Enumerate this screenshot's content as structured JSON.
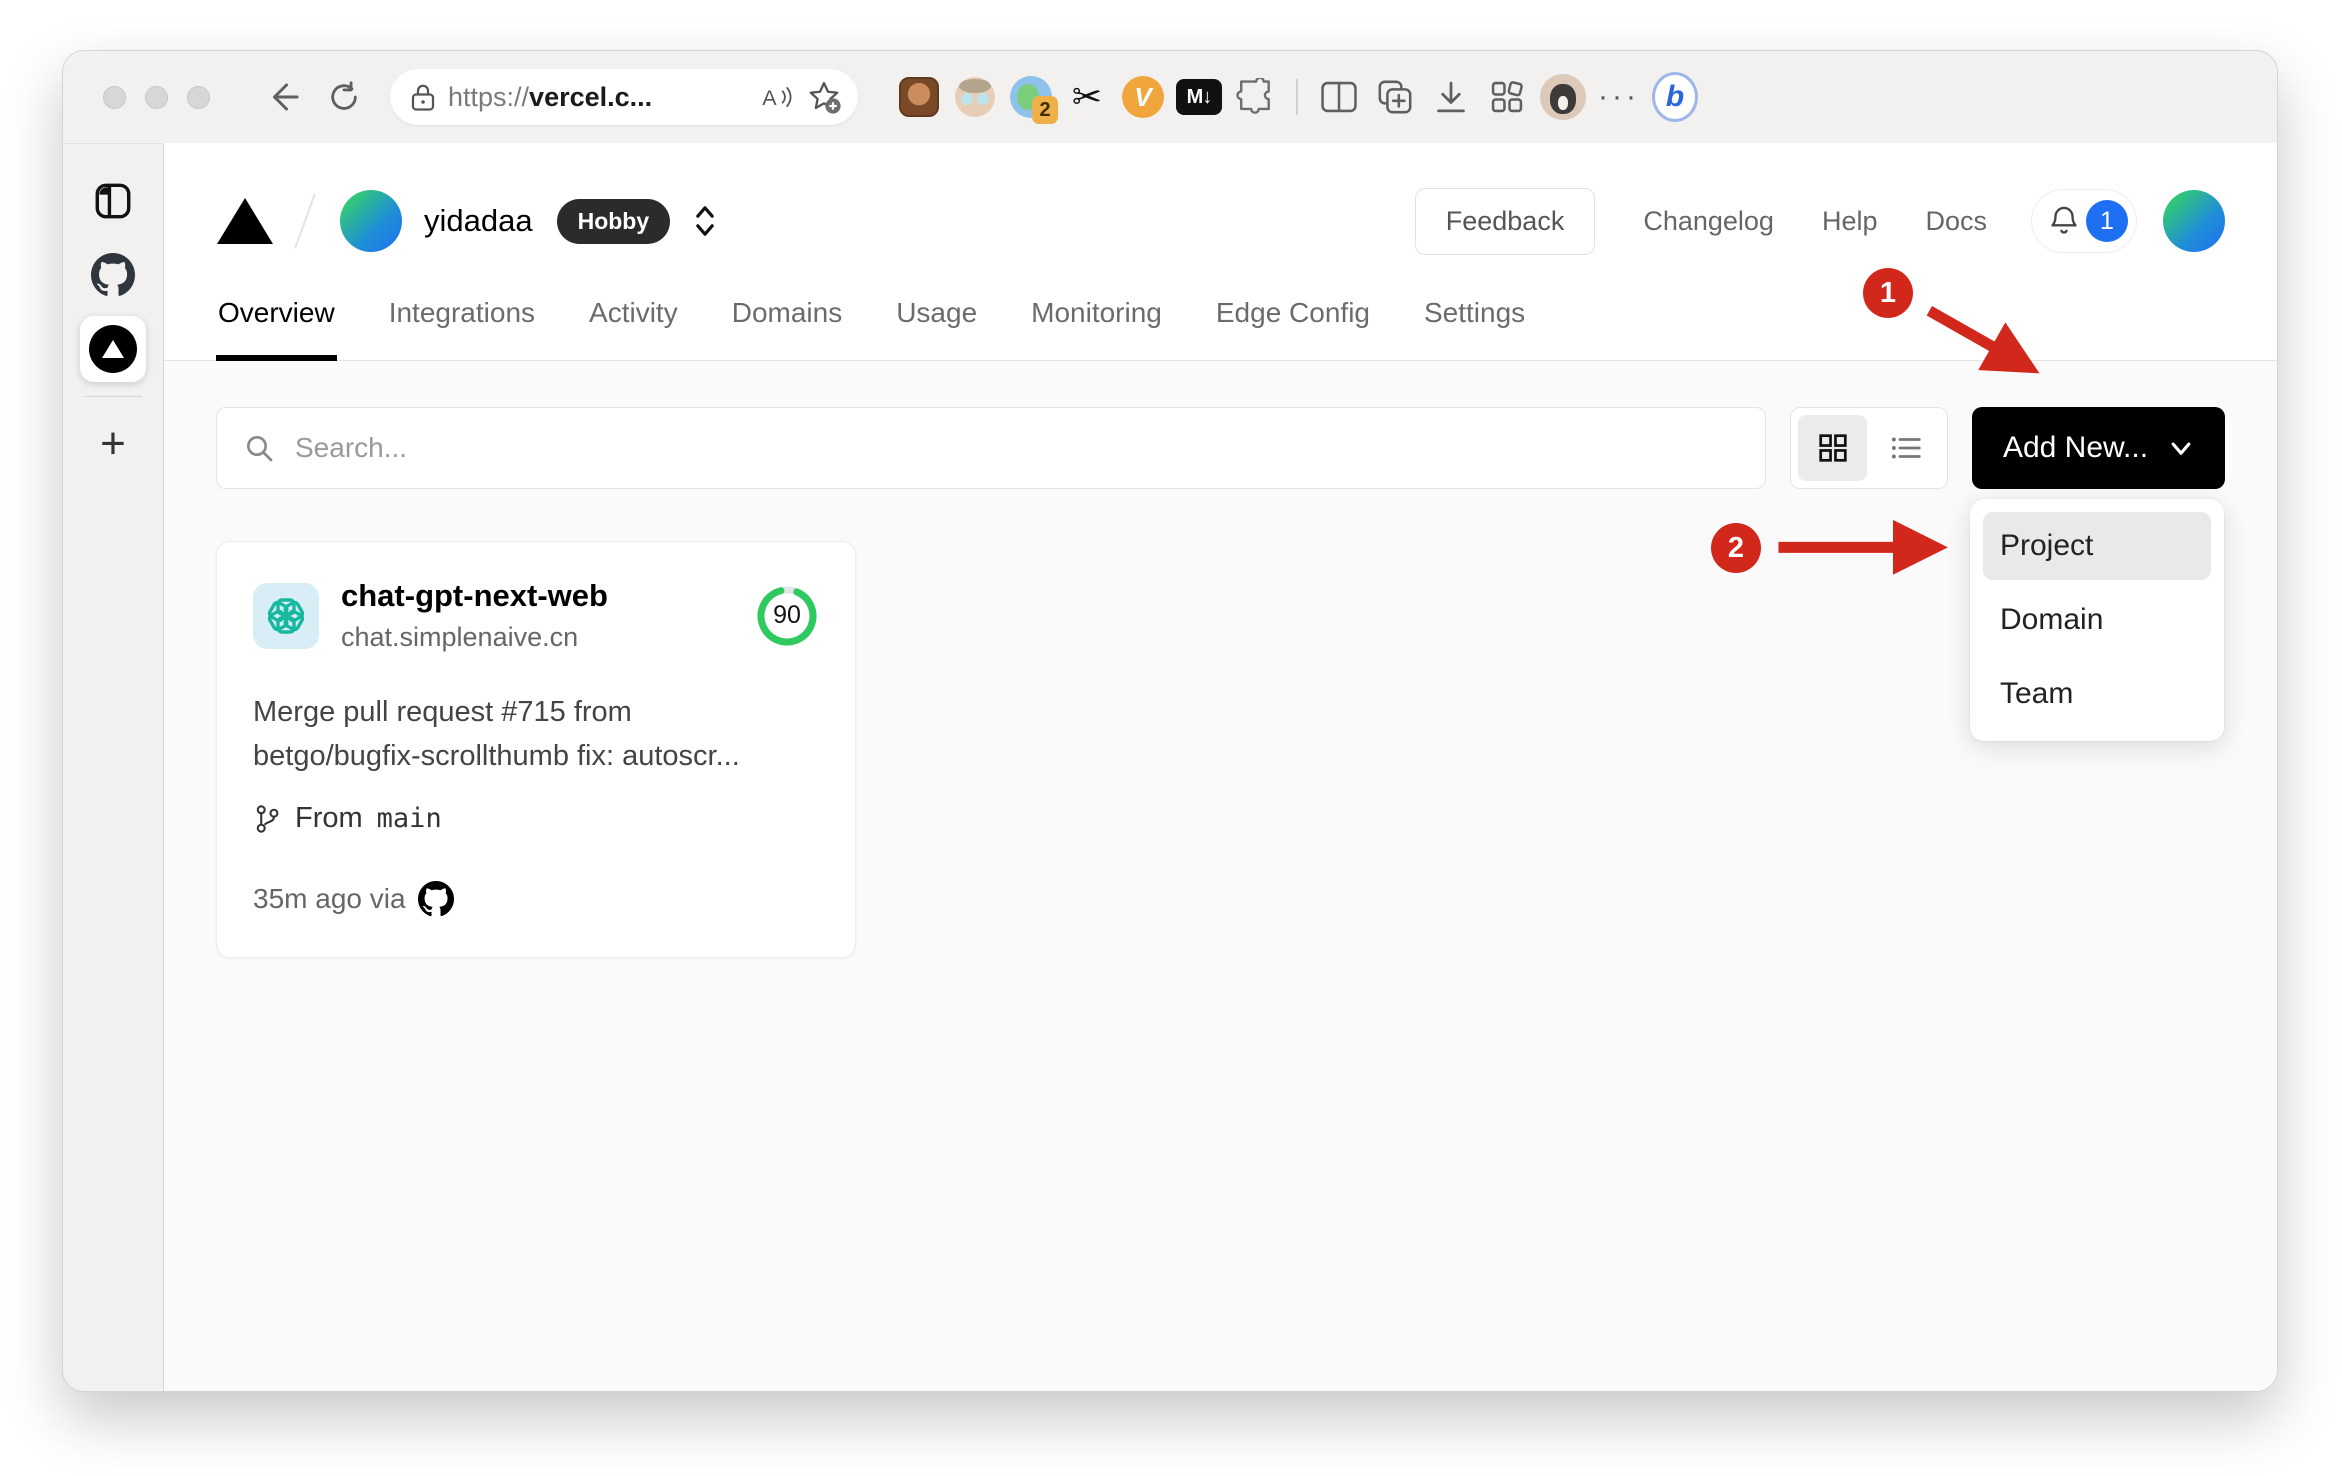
{
  "browser": {
    "window_controls": [
      "close",
      "minimize",
      "zoom"
    ],
    "url": {
      "prefix": "https://",
      "host": "vercel.c..."
    },
    "more_label": "...",
    "proxy_badge_count": "2",
    "markdown_ext_label": "M↓",
    "v_ext_label": "V",
    "bing_label": "b",
    "toolbar_icons": [
      "back",
      "refresh",
      "lock",
      "read-aloud",
      "add-favorite",
      "tampermonkey",
      "granny-emoji",
      "proxy",
      "scissors",
      "v-extension",
      "markdown-downloader",
      "extensions-puzzle",
      "split-screen",
      "collections-add",
      "downloads",
      "apps-launcher",
      "profile-avatar",
      "more-options",
      "bing-chat"
    ]
  },
  "vtabs": {
    "new_tab_label": "+"
  },
  "site": {
    "header": {
      "team": "yidadaa",
      "plan_badge": "Hobby",
      "feedback_label": "Feedback",
      "links": [
        {
          "label": "Changelog"
        },
        {
          "label": "Help"
        },
        {
          "label": "Docs"
        }
      ],
      "notification_count": "1"
    },
    "nav": {
      "tabs": [
        {
          "label": "Overview",
          "active": true
        },
        {
          "label": "Integrations"
        },
        {
          "label": "Activity"
        },
        {
          "label": "Domains"
        },
        {
          "label": "Usage"
        },
        {
          "label": "Monitoring"
        },
        {
          "label": "Edge Config"
        },
        {
          "label": "Settings"
        }
      ]
    },
    "controls": {
      "search_placeholder": "Search...",
      "add_new_label": "Add New..."
    },
    "dropdown": {
      "items": [
        {
          "label": "Project",
          "highlighted": true
        },
        {
          "label": "Domain"
        },
        {
          "label": "Team"
        }
      ]
    },
    "project_card": {
      "name": "chat-gpt-next-web",
      "domain": "chat.simplenaive.cn",
      "score": "90",
      "commit_lines": [
        "Merge pull request #715 from",
        "betgo/bugfix-scrollthumb fix: autoscr..."
      ],
      "branch_prefix": "From",
      "branch_name": "main",
      "deployed": "35m ago via"
    },
    "annotations": {
      "step1": "1",
      "step2": "2"
    }
  },
  "colors": {
    "accent_blue": "#1f6ff2",
    "ring_green": "#2fca5f",
    "annotation_red": "#d2281c",
    "badge_dark": "#2b2b2b",
    "button_black": "#000000"
  }
}
